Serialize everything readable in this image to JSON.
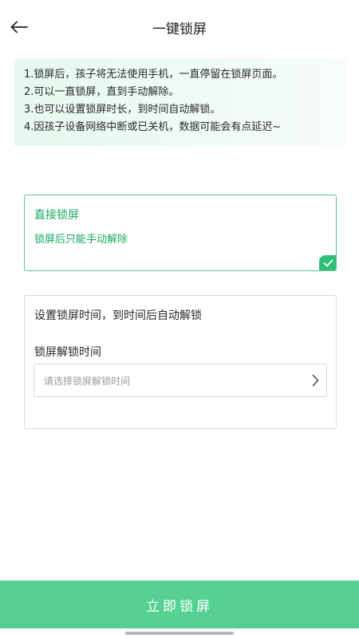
{
  "header": {
    "title": "一键锁屏",
    "back_icon": "arrow-left-icon"
  },
  "notice": {
    "lines": [
      "1.锁屏后，孩子将无法使用手机，一直停留在锁屏页面。",
      "2.可以一直锁屏，直到手动解除。",
      "3.也可以设置锁屏时长，到时间自动解锁。",
      "4.因孩子设备网络中断或已关机，数据可能会有点延迟~"
    ]
  },
  "direct_lock": {
    "title": "直接锁屏",
    "description": "锁屏后只能手动解除",
    "selected": true,
    "check_icon": "check-icon"
  },
  "timed_lock": {
    "title": "设置锁屏时间，到时间后自动解锁",
    "field_label": "锁屏解锁时间",
    "placeholder": "请选择锁屏解锁时间",
    "chevron_icon": "chevron-right-icon"
  },
  "action": {
    "lock_label": "立即锁屏"
  },
  "colors": {
    "accent": "#17a860",
    "accent_border": "#5cc78e",
    "button": "#56d192",
    "notice_bg": "#e6f8ef"
  }
}
